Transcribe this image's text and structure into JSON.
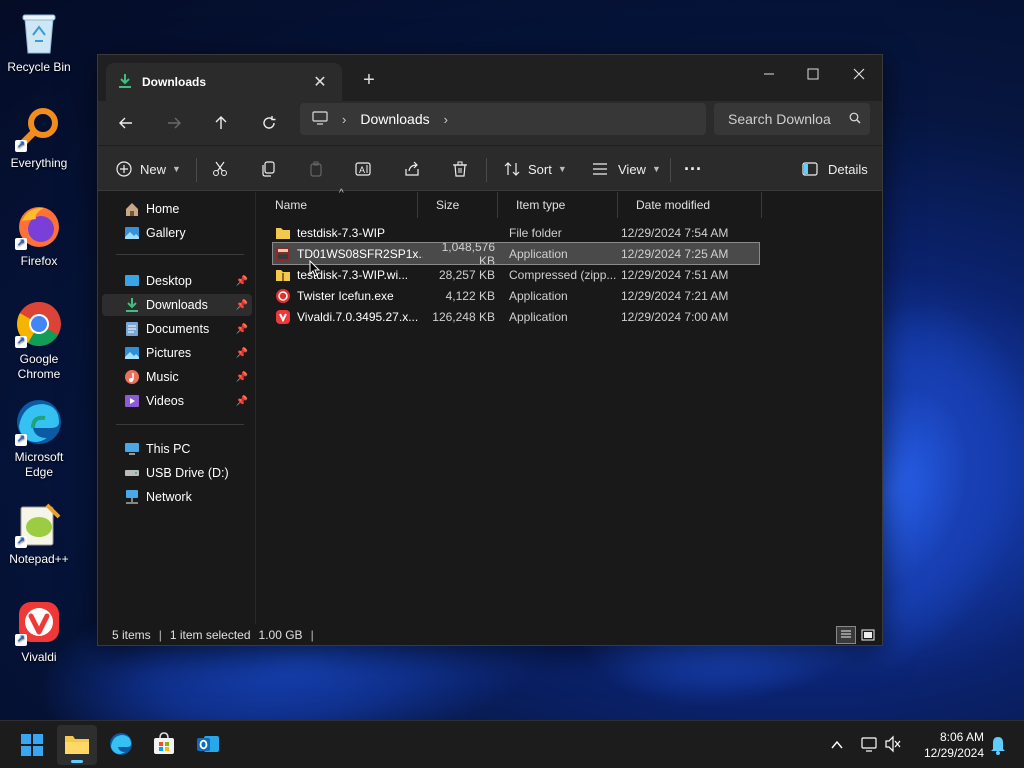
{
  "desktop": {
    "icons": [
      {
        "label": "Recycle Bin"
      },
      {
        "label": "Everything"
      },
      {
        "label": "Firefox"
      },
      {
        "label": "Google Chrome"
      },
      {
        "label": "Microsoft Edge"
      },
      {
        "label": "Notepad++"
      },
      {
        "label": "Vivaldi"
      }
    ]
  },
  "window": {
    "tab_title": "Downloads",
    "new_tab": "+",
    "address": {
      "segment": "Downloads"
    },
    "search_placeholder": "Search Downloa",
    "toolbar": {
      "new_label": "New",
      "sort_label": "Sort",
      "view_label": "View",
      "more_label": "···",
      "details_label": "Details"
    },
    "nav_pane": {
      "quick": [
        {
          "label": "Home"
        },
        {
          "label": "Gallery"
        }
      ],
      "pinned": [
        {
          "label": "Desktop"
        },
        {
          "label": "Downloads"
        },
        {
          "label": "Documents"
        },
        {
          "label": "Pictures"
        },
        {
          "label": "Music"
        },
        {
          "label": "Videos"
        }
      ],
      "devices": [
        {
          "label": "This PC"
        },
        {
          "label": "USB Drive (D:)"
        },
        {
          "label": "Network"
        }
      ]
    },
    "columns": {
      "name": "Name",
      "size": "Size",
      "type": "Item type",
      "date": "Date modified"
    },
    "files": [
      {
        "name": "testdisk-7.3-WIP",
        "size": "",
        "type": "File folder",
        "date": "12/29/2024 7:54 AM"
      },
      {
        "name": "TD01WS08SFR2SP1x...",
        "size": "1,048,576 KB",
        "type": "Application",
        "date": "12/29/2024 7:25 AM"
      },
      {
        "name": "testdisk-7.3-WIP.wi...",
        "size": "28,257 KB",
        "type": "Compressed (zipp...",
        "date": "12/29/2024 7:51 AM"
      },
      {
        "name": "Twister Icefun.exe",
        "size": "4,122 KB",
        "type": "Application",
        "date": "12/29/2024 7:21 AM"
      },
      {
        "name": "Vivaldi.7.0.3495.27.x...",
        "size": "126,248 KB",
        "type": "Application",
        "date": "12/29/2024 7:00 AM"
      }
    ],
    "status": {
      "items": "5 items",
      "selected": "1 item selected",
      "size": "1.00 GB"
    }
  },
  "taskbar": {
    "clock_time": "8:06 AM",
    "clock_date": "12/29/2024"
  },
  "colors": {
    "accent": "#60cdff",
    "folder": "#f2c94c",
    "window_bg": "#191919",
    "toolbar_bg": "#2b2b2b"
  }
}
